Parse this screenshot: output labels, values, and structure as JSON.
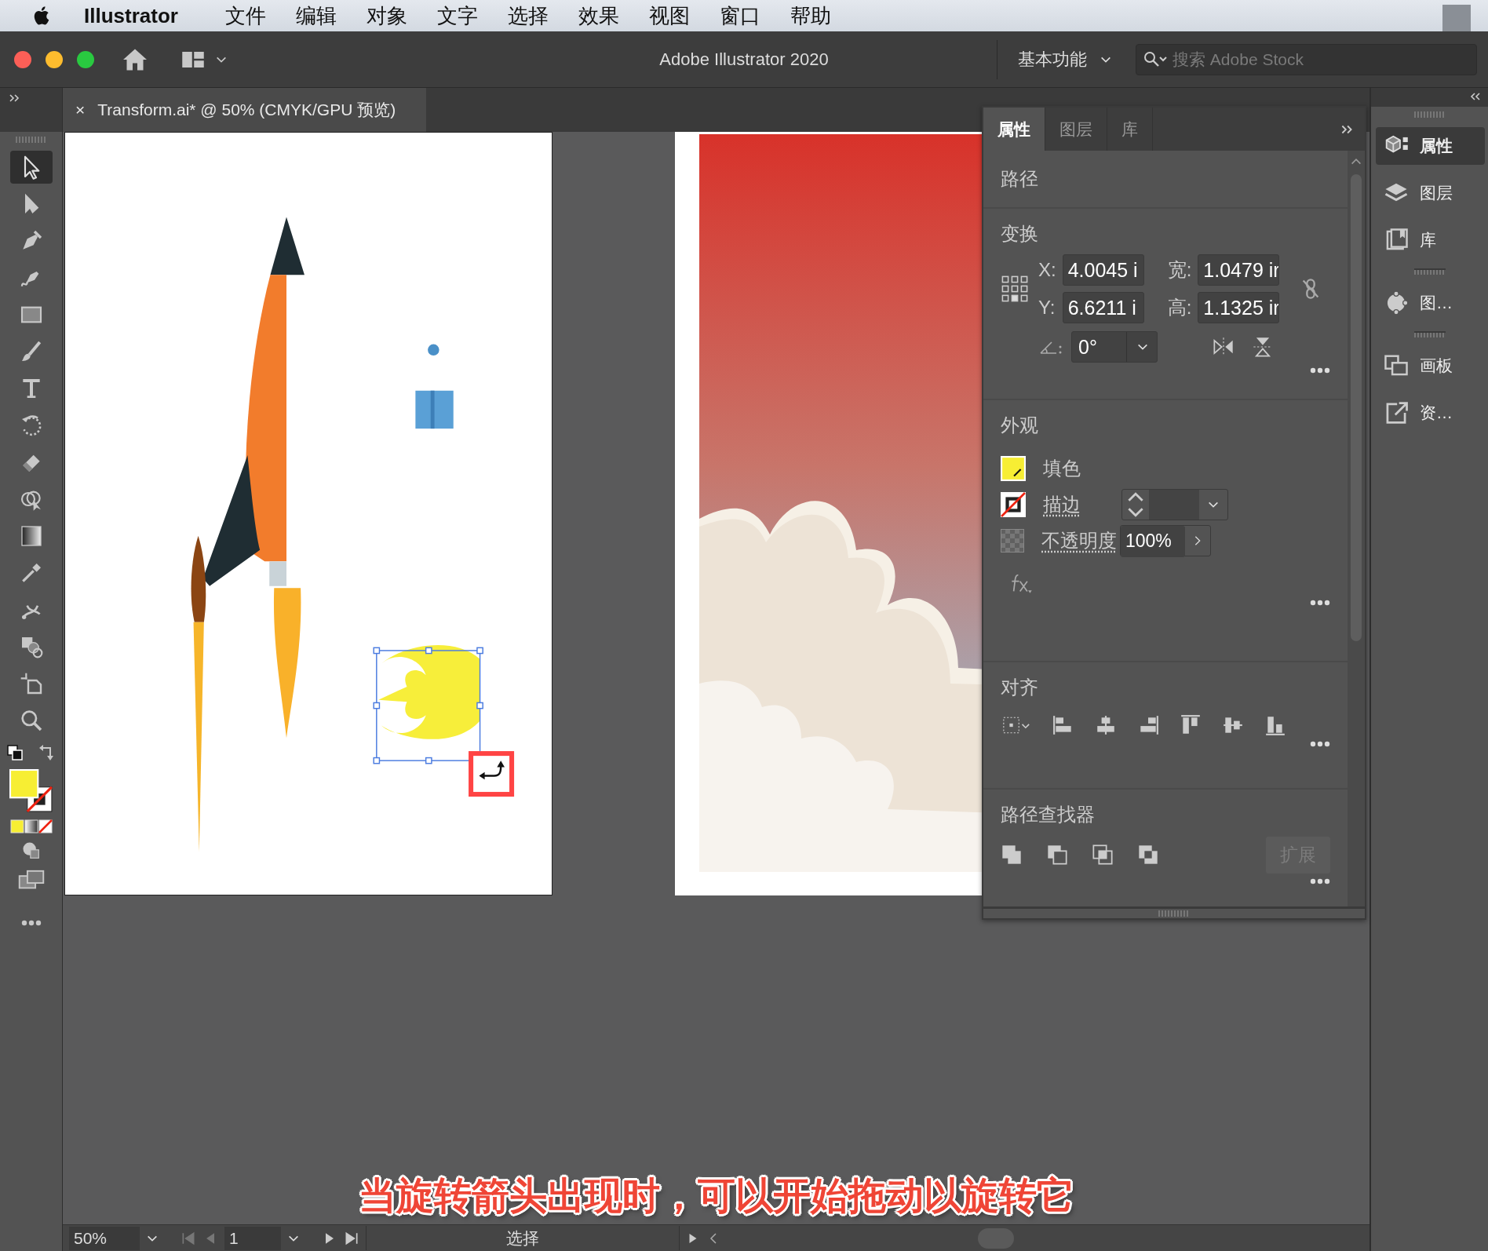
{
  "menu_bar": {
    "app_name": "Illustrator",
    "items": [
      "文件",
      "编辑",
      "对象",
      "文字",
      "选择",
      "效果",
      "视图",
      "窗口",
      "帮助"
    ]
  },
  "title_bar": {
    "title": "Adobe Illustrator 2020",
    "workspace": "基本功能",
    "search": {
      "placeholder": "搜索 Adobe Stock"
    }
  },
  "document_tab": {
    "close": "×",
    "title": "Transform.ai* @ 50% (CMYK/GPU 预览)"
  },
  "tools": [
    {
      "kind": "selection",
      "selected": true
    },
    {
      "kind": "direct-selection",
      "selected": false
    },
    {
      "kind": "pen",
      "selected": false
    },
    {
      "kind": "curvature",
      "selected": false
    },
    {
      "kind": "rectangle",
      "selected": false
    },
    {
      "kind": "paintbrush",
      "selected": false
    },
    {
      "kind": "type",
      "selected": false
    },
    {
      "kind": "rotate",
      "selected": false
    },
    {
      "kind": "eraser",
      "selected": false
    },
    {
      "kind": "shape-builder",
      "selected": false
    },
    {
      "kind": "gradient",
      "selected": false
    },
    {
      "kind": "eyedropper",
      "selected": false
    },
    {
      "kind": "puppet-warp",
      "selected": false
    },
    {
      "kind": "shapes",
      "selected": false
    },
    {
      "kind": "artboard",
      "selected": false
    },
    {
      "kind": "zoom",
      "selected": false
    }
  ],
  "properties_panel": {
    "tabs": [
      {
        "label": "属性",
        "selected": true
      },
      {
        "label": "图层",
        "selected": false
      },
      {
        "label": "库",
        "selected": false
      }
    ],
    "selection_type": "路径",
    "transform": {
      "title": "变换",
      "x_label": "X:",
      "x": "4.0045 i",
      "width_label": "宽:",
      "width": "1.0479 ir",
      "y_label": "Y:",
      "y": "6.6211 i",
      "height_label": "高:",
      "height": "1.1325 ir",
      "angle": "0°"
    },
    "appearance": {
      "title": "外观",
      "fill_label": "填色",
      "stroke_label": "描边",
      "opacity_label": "不透明度",
      "opacity": "100%"
    },
    "align": {
      "title": "对齐"
    },
    "pathfinder": {
      "title": "路径查找器",
      "expand": {
        "label": "扩展",
        "disabled": true
      }
    }
  },
  "dock": [
    {
      "kind": "properties",
      "label": "属性",
      "selected": true
    },
    {
      "kind": "layers",
      "label": "图层",
      "selected": false
    },
    {
      "kind": "libraries",
      "label": "库",
      "selected": false
    },
    {
      "kind": "graphic-styles",
      "label": "图…",
      "selected": false
    },
    {
      "kind": "artboards",
      "label": "画板",
      "selected": false
    },
    {
      "kind": "export",
      "label": "资…",
      "selected": false
    }
  ],
  "caption": "当旋转箭头出现时，可以开始拖动以旋转它",
  "status_bar": {
    "zoom": "50%",
    "artboard": "1",
    "tool": "选择"
  }
}
